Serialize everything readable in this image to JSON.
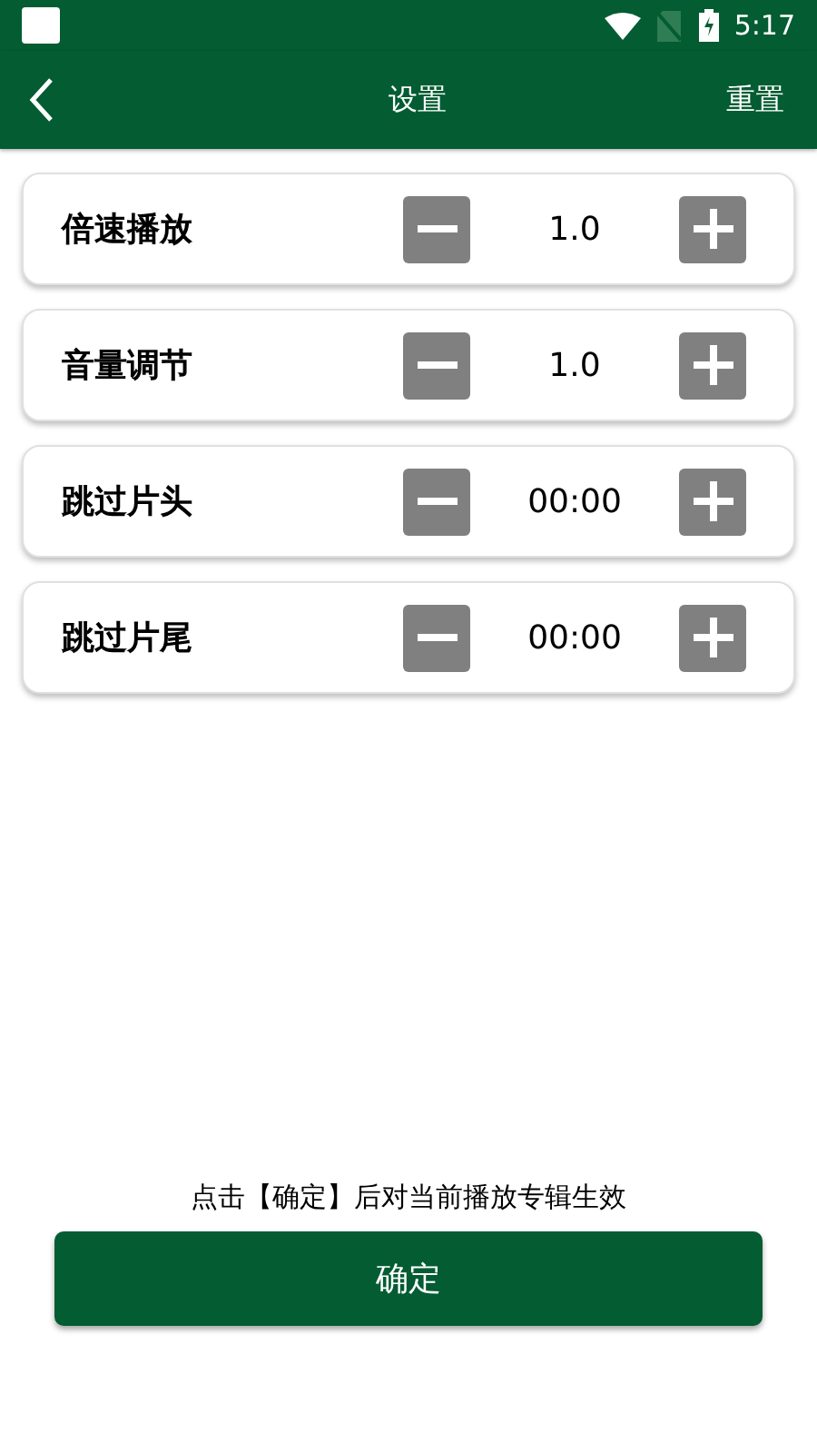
{
  "status_bar": {
    "time": "5:17"
  },
  "header": {
    "title": "设置",
    "action": "重置"
  },
  "settings": [
    {
      "label": "倍速播放",
      "value": "1.0"
    },
    {
      "label": "音量调节",
      "value": "1.0"
    },
    {
      "label": "跳过片头",
      "value": "00:00"
    },
    {
      "label": "跳过片尾",
      "value": "00:00"
    }
  ],
  "note": "点击【确定】后对当前播放专辑生效",
  "confirm_button": "确定"
}
